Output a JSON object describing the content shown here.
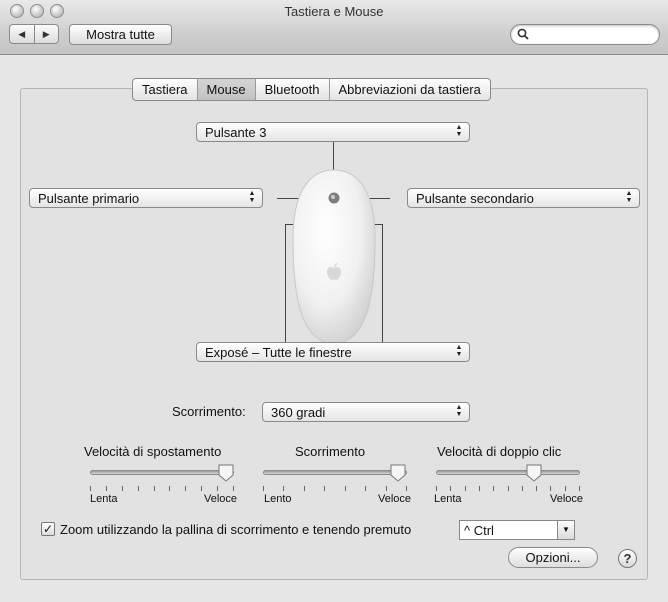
{
  "window": {
    "title": "Tastiera e Mouse"
  },
  "toolbar": {
    "back_icon": "triangle-left-icon",
    "forward_icon": "triangle-right-icon",
    "show_all_label": "Mostra tutte",
    "search_placeholder": ""
  },
  "tabs": [
    {
      "label": "Tastiera",
      "active": false
    },
    {
      "label": "Mouse",
      "active": true
    },
    {
      "label": "Bluetooth",
      "active": false
    },
    {
      "label": "Abbreviazioni da tastiera",
      "active": false
    }
  ],
  "mouse": {
    "button3": "Pulsante 3",
    "left_button": "Pulsante primario",
    "right_button": "Pulsante secondario",
    "side_buttons": "Exposé – Tutte le finestre"
  },
  "scrolling": {
    "label": "Scorrimento:",
    "value": "360 gradi"
  },
  "sliders": [
    {
      "title": "Velocità di spostamento",
      "min_label": "Lenta",
      "max_label": "Veloce",
      "position": 1.0,
      "ticks": 10
    },
    {
      "title": "Scorrimento",
      "min_label": "Lento",
      "max_label": "Veloce",
      "position": 0.95,
      "ticks": 8
    },
    {
      "title": "Velocità di doppio clic",
      "min_label": "Lenta",
      "max_label": "Veloce",
      "position": 0.68,
      "ticks": 11
    }
  ],
  "zoom": {
    "checked": true,
    "check_mark": "✓",
    "label": "Zoom utilizzando la pallina di scorrimento e tenendo premuto",
    "modifier": "^ Ctrl"
  },
  "options_button": "Opzioni...",
  "help_button": "?",
  "colors": {
    "window_bg": "#e6e6e6",
    "panel_bg": "#e2e2e2"
  }
}
